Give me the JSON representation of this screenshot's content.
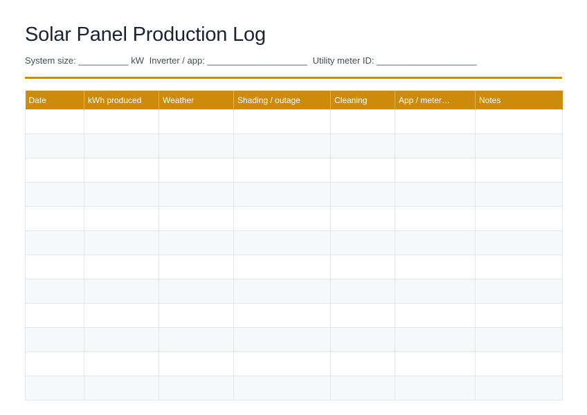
{
  "title": "Solar Panel Production Log",
  "meta": {
    "system_size": "System size: __________ kW",
    "inverter": "Inverter / app: ____________________",
    "meter": "Utility meter ID: ____________________"
  },
  "colors": {
    "accent": "#cc8b0a",
    "row_alt": "#f7f8fa",
    "grid": "#e3e6ea"
  },
  "table": {
    "headers": [
      "Date",
      "kWh produced",
      "Weather",
      "Shading / outage",
      "Cleaning",
      "App / meter…",
      "Notes"
    ],
    "row_count": 12
  }
}
